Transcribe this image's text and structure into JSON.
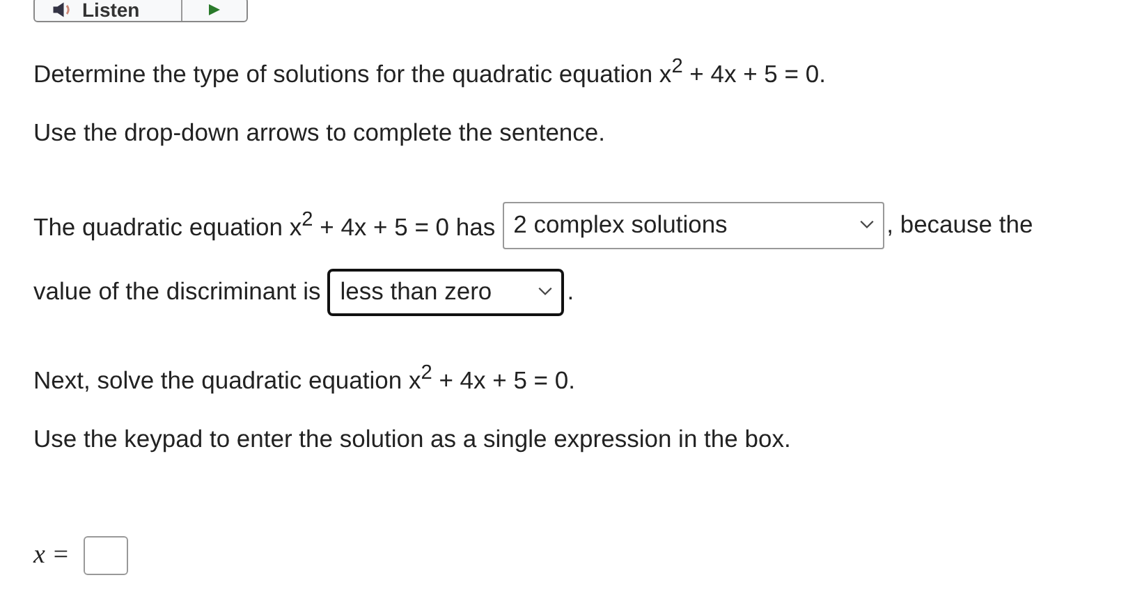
{
  "listen_button": {
    "label": "Listen"
  },
  "prompt": "Determine the type of solutions for the quadratic equation x$^{2}$ + 4x + 5 = 0.",
  "instruction_1": "Use the drop-down arrows to complete the sentence.",
  "sentence": [
    {
      "kind": "text",
      "text": "The quadratic equation x$^{2}$ + 4x + 5 = 0 has"
    },
    {
      "kind": "dropdown",
      "value": "2 complex solutions",
      "focused": false,
      "wide": true
    },
    {
      "kind": "text",
      "text": ", because the"
    },
    {
      "kind": "break"
    },
    {
      "kind": "text",
      "text": "value of the discriminant is"
    },
    {
      "kind": "dropdown",
      "value": "less than zero",
      "focused": true,
      "wide": false
    },
    {
      "kind": "text",
      "text": "."
    }
  ],
  "prompt_2": "Next, solve the quadratic equation x$^{2}$ + 4x + 5 = 0.",
  "instruction_2": "Use the keypad to enter the solution as a single expression in the box.",
  "answer": {
    "label": "x ="
  }
}
